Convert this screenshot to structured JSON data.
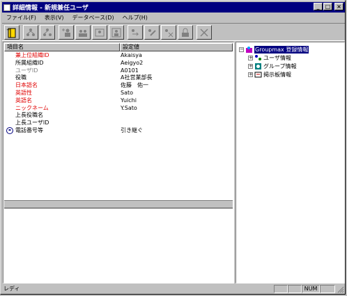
{
  "window": {
    "title": "詳細情報 - 新規兼任ユーザ"
  },
  "menu": [
    {
      "label": "ファイル(F)"
    },
    {
      "label": "表示(V)"
    },
    {
      "label": "データベース(D)"
    },
    {
      "label": "ヘルプ(H)"
    }
  ],
  "toolbar": {
    "icons": [
      "open-book-icon",
      "users-link-icon",
      "users-unlink-icon",
      "add-user-icon",
      "user-group-icon",
      "user-card-icon",
      "person-frame-icon",
      "move-link-icon",
      "link-edit-icon",
      "unlink-edit-icon",
      "lock-icon",
      "delete-icon"
    ]
  },
  "list": {
    "headers": {
      "name": "項目名",
      "value": "設定値"
    },
    "rows": [
      {
        "name": "兼上位組織ID",
        "value": "Akaisya",
        "color": "red"
      },
      {
        "name": "所属組織ID",
        "value": "Aeigyo2",
        "color": "black"
      },
      {
        "name": "ユーザID",
        "value": "A0101",
        "color": "gray"
      },
      {
        "name": "役職",
        "value": "A社営業部長",
        "color": "black"
      },
      {
        "name": "日本語名",
        "value": "佐藤　佑一",
        "color": "red"
      },
      {
        "name": "英語性",
        "value": "Sato",
        "color": "red"
      },
      {
        "name": "英語名",
        "value": "Yuichi",
        "color": "red"
      },
      {
        "name": "ニックネーム",
        "value": "Y.Sato",
        "color": "red"
      },
      {
        "name": "上長役職名",
        "value": "",
        "color": "black"
      },
      {
        "name": "上長ユーザID",
        "value": "",
        "color": "black"
      },
      {
        "name": "電話番号等",
        "value": "引き継ぐ",
        "color": "black",
        "icon": "phone-icon"
      }
    ]
  },
  "tree": {
    "root": {
      "label": "Groupmax 登録情報",
      "icon": "groupmax-icon",
      "expander": "−"
    },
    "children": [
      {
        "label": "ユーザ情報",
        "icon": "users-icon",
        "expander": "+"
      },
      {
        "label": "グループ情報",
        "icon": "group-icon",
        "expander": "+"
      },
      {
        "label": "掲示板情報",
        "icon": "board-icon",
        "expander": "+"
      }
    ]
  },
  "status": {
    "text": "レディ",
    "indicator": "NUM"
  }
}
